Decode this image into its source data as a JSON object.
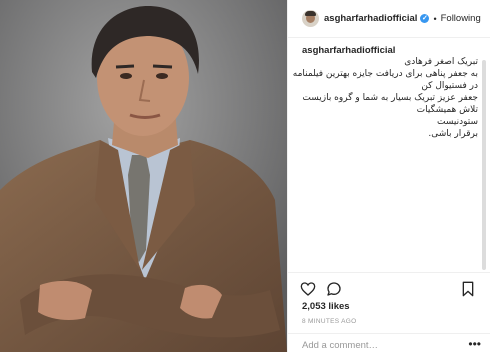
{
  "post": {
    "username": "asgharfarhadiofficial",
    "separator": "•",
    "follow_label": "Following",
    "caption": {
      "username": "asgharfarhadiofficial",
      "lines": [
        "تبریک اصغر فرهادی",
        "به جعفر پناهی برای دریافت جایزه بهترین فیلمنامه",
        "در فستیوال کن",
        "جعفر عزیز تبریک بسیار به شما و گروه بازیست",
        "تلاش همیشگیات",
        "ستودنیست",
        "برقرار باشی."
      ]
    },
    "likes": "2,053 likes",
    "timestamp": "8 MINUTES AGO",
    "comment_placeholder": "Add a comment…",
    "more_label": "•••",
    "icons": {
      "avatar": "profile-avatar",
      "verified": "verified-badge-icon",
      "like": "heart-icon",
      "comment": "comment-bubble-icon",
      "save": "bookmark-icon"
    },
    "colors": {
      "verified": "#3897f0",
      "text": "#262626",
      "muted": "#999999"
    }
  }
}
